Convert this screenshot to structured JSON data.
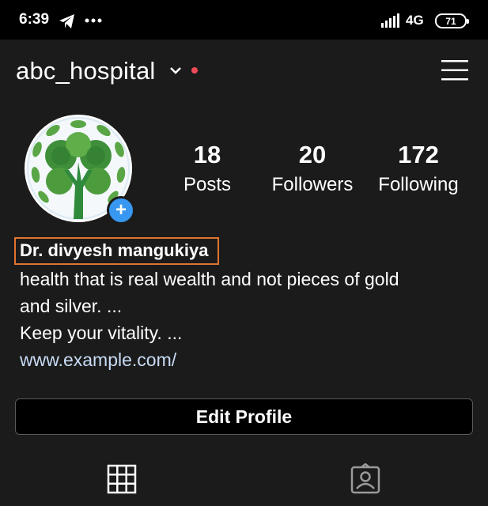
{
  "status_bar": {
    "time": "6:39",
    "icons": [
      "telegram-icon",
      "more-dots-icon",
      "signal-icon",
      "battery-icon"
    ],
    "network": "4G",
    "battery": "71"
  },
  "header": {
    "username": "abc_hospital",
    "icons": [
      "chevron-down-icon",
      "hamburger-menu-icon"
    ],
    "notification_dot_color": "#ed4956"
  },
  "profile": {
    "stats": [
      {
        "value": "18",
        "label": "Posts"
      },
      {
        "value": "20",
        "label": "Followers"
      },
      {
        "value": "172",
        "label": "Following"
      }
    ],
    "name": "Dr. divyesh mangukiya",
    "bio_lines": [
      "health that is real wealth and not pieces of gold",
      "and silver. ...",
      "Keep your vitality. ..."
    ],
    "website": "www.example.com/",
    "add_story_icon": "plus-icon",
    "highlight_color": "#e0742f"
  },
  "actions": {
    "edit_profile": "Edit Profile"
  },
  "tabs": [
    "grid-icon",
    "tagged-person-icon"
  ],
  "colors": {
    "background": "#1b1b1b",
    "accent_blue": "#3897f0",
    "link": "#c8dbf5"
  }
}
